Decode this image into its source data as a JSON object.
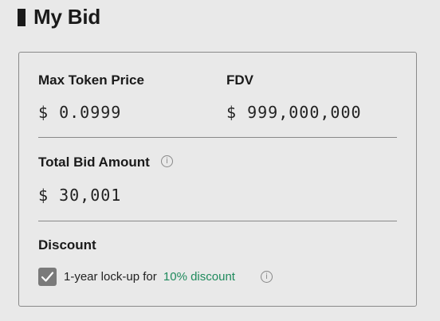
{
  "header": {
    "title": "My Bid"
  },
  "fields": {
    "max_price_label": "Max Token Price",
    "max_price_value": "$ 0.0999",
    "fdv_label": "FDV",
    "fdv_value": "$ 999,000,000",
    "total_label": "Total Bid Amount",
    "total_value": "$ 30,001"
  },
  "discount": {
    "label": "Discount",
    "lockup_text": "1-year lock-up for",
    "discount_text": "10% discount",
    "checked": true
  },
  "icons": [
    "info-icon",
    "checkmark-icon"
  ],
  "colors": {
    "accent": "#1f8a5c",
    "checkbox": "#7a7a7a",
    "border": "#8a8a8a"
  }
}
